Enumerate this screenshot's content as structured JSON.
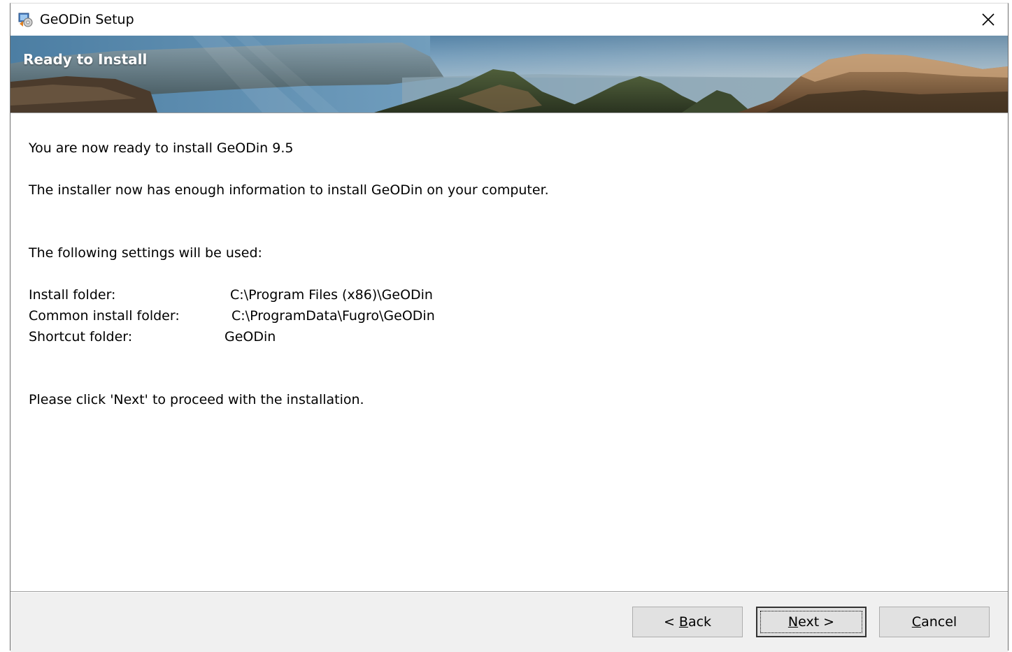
{
  "window": {
    "title": "GeODin Setup"
  },
  "banner": {
    "title": "Ready to Install"
  },
  "content": {
    "line1": "You are now ready to install GeODin 9.5",
    "line2": "The installer now has enough information to install GeODin on your computer.",
    "line3": "The following settings will be used:",
    "settings": [
      {
        "label": "Install folder:",
        "value": "C:\\Program Files (x86)\\GeODin"
      },
      {
        "label": "Common install folder:",
        "value": "C:\\ProgramData\\Fugro\\GeODin"
      },
      {
        "label": "Shortcut folder:",
        "value": "GeODin"
      }
    ],
    "line4": "Please click 'Next' to proceed with the installation."
  },
  "buttons": {
    "back": {
      "prefix": "< ",
      "mnemonic": "B",
      "rest": "ack"
    },
    "next": {
      "prefix": "",
      "mnemonic": "N",
      "rest": "ext >"
    },
    "cancel": {
      "prefix": "",
      "mnemonic": "C",
      "rest": "ancel"
    }
  }
}
